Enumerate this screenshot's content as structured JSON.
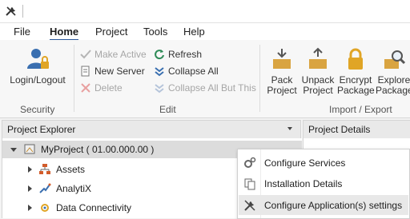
{
  "menubar": {
    "items": [
      "File",
      "Home",
      "Project",
      "Tools",
      "Help"
    ],
    "active": "Home"
  },
  "ribbon": {
    "security": {
      "login_label_1": "Login/Logout",
      "group_label": "Security"
    },
    "edit": {
      "make_active": "Make Active",
      "new_server": "New Server",
      "delete": "Delete",
      "refresh": "Refresh",
      "collapse_all": "Collapse All",
      "collapse_all_but_this": "Collapse All But This",
      "group_label": "Edit"
    },
    "import_export": {
      "pack_1": "Pack",
      "pack_2": "Project",
      "unpack_1": "Unpack",
      "unpack_2": "Project",
      "encrypt_1": "Encrypt",
      "encrypt_2": "Package",
      "explore_1": "Explore",
      "explore_2": "Package",
      "group_label": "Import / Export"
    }
  },
  "project_explorer": {
    "title": "Project Explorer",
    "root": "MyProject ( 01.00.000.00 )",
    "children": [
      "Assets",
      "AnalytiX",
      "Data Connectivity"
    ]
  },
  "project_details": {
    "title": "Project Details"
  },
  "context_menu": {
    "items": [
      "Configure Services",
      "Installation Details",
      "Configure Application(s) settings"
    ]
  },
  "colors": {
    "accent": "#2b579a",
    "menu_hover": "#e8e8e8",
    "selection": "#dcdcdc"
  }
}
